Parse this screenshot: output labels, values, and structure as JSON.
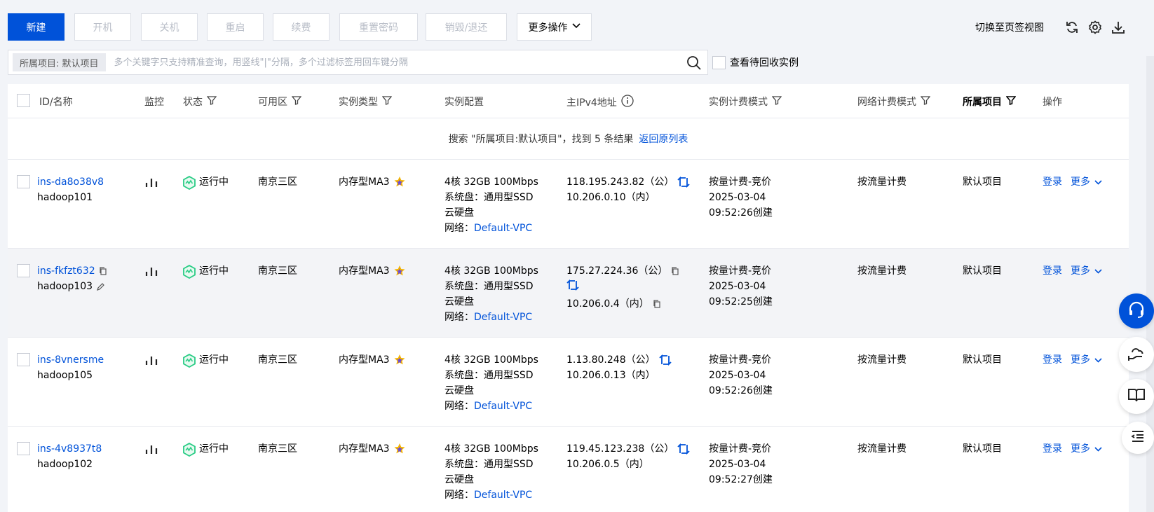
{
  "toolbar": {
    "buttons": [
      {
        "label": "新建",
        "state": "primary"
      },
      {
        "label": "开机",
        "state": "disabled"
      },
      {
        "label": "关机",
        "state": "disabled"
      },
      {
        "label": "重启",
        "state": "disabled"
      },
      {
        "label": "续费",
        "state": "disabled"
      },
      {
        "label": "重置密码",
        "state": "disabled"
      },
      {
        "label": "销毁/退还",
        "state": "disabled"
      },
      {
        "label": "更多操作",
        "state": "enabled"
      }
    ],
    "switch_view_label": "切换至页签视图",
    "icons": [
      "refresh-icon",
      "gear-icon",
      "download-icon"
    ]
  },
  "search": {
    "tag": "所属项目: 默认项目",
    "placeholder": "多个关键字只支持精准查询，用竖线\"|\"分隔，多个过滤标签用回车键分隔",
    "recycle_label": "查看待回收实例"
  },
  "table": {
    "headers": {
      "id": "ID/名称",
      "monitor": "监控",
      "status": "状态",
      "zone": "可用区",
      "type": "实例类型",
      "config": "实例配置",
      "ip": "主IPv4地址",
      "billing": "实例计费模式",
      "net_billing": "网络计费模式",
      "project": "所属项目",
      "action": "操作"
    },
    "result_text": "搜索 \"所属项目:默认项目\"，找到 5 条结果",
    "back_link": "返回原列表",
    "rows": [
      {
        "id": "ins-da8o38v8",
        "name": "hadoop101",
        "status": "运行中",
        "zone": "南京三区",
        "type": "内存型MA3",
        "config1": "4核 32GB 100Mbps",
        "config2": "系统盘：通用型SSD",
        "config3": "云硬盘",
        "net_prefix": "网络：",
        "vpc": "Default-VPC",
        "ip_pub": "118.195.243.82（公）",
        "ip_pri": "10.206.0.10（内）",
        "billing1": "按量计费-竞价",
        "billing2": "2025-03-04",
        "billing3": "09:52:26创建",
        "net_billing": "按流量计费",
        "project": "默认项目",
        "login": "登录",
        "more": "更多"
      },
      {
        "id": "ins-fkfzt632",
        "name": "hadoop103",
        "status": "运行中",
        "zone": "南京三区",
        "type": "内存型MA3",
        "config1": "4核 32GB 100Mbps",
        "config2": "系统盘：通用型SSD",
        "config3": "云硬盘",
        "net_prefix": "网络：",
        "vpc": "Default-VPC",
        "ip_pub": "175.27.224.36（公）",
        "ip_pri": "10.206.0.4（内）",
        "billing1": "按量计费-竞价",
        "billing2": "2025-03-04",
        "billing3": "09:52:25创建",
        "net_billing": "按流量计费",
        "project": "默认项目",
        "login": "登录",
        "more": "更多"
      },
      {
        "id": "ins-8vnersme",
        "name": "hadoop105",
        "status": "运行中",
        "zone": "南京三区",
        "type": "内存型MA3",
        "config1": "4核 32GB 100Mbps",
        "config2": "系统盘：通用型SSD",
        "config3": "云硬盘",
        "net_prefix": "网络：",
        "vpc": "Default-VPC",
        "ip_pub": "1.13.80.248（公）",
        "ip_pri": "10.206.0.13（内）",
        "billing1": "按量计费-竞价",
        "billing2": "2025-03-04",
        "billing3": "09:52:26创建",
        "net_billing": "按流量计费",
        "project": "默认项目",
        "login": "登录",
        "more": "更多"
      },
      {
        "id": "ins-4v8937t8",
        "name": "hadoop102",
        "status": "运行中",
        "zone": "南京三区",
        "type": "内存型MA3",
        "config1": "4核 32GB 100Mbps",
        "config2": "系统盘：通用型SSD",
        "config3": "云硬盘",
        "net_prefix": "网络：",
        "vpc": "Default-VPC",
        "ip_pub": "119.45.123.238（公）",
        "ip_pri": "10.206.0.5（内）",
        "billing1": "按量计费-竞价",
        "billing2": "2025-03-04",
        "billing3": "09:52:27创建",
        "net_billing": "按流量计费",
        "project": "默认项目",
        "login": "登录",
        "more": "更多"
      }
    ]
  },
  "colors": {
    "primary": "#0052d9",
    "link": "#0052d9",
    "running_green": "#29cc85",
    "disabled_text": "#b8bdc7"
  },
  "floatbar_icons": [
    "headset-icon",
    "cloud-hand-icon",
    "book-icon",
    "list-collapse-icon"
  ]
}
